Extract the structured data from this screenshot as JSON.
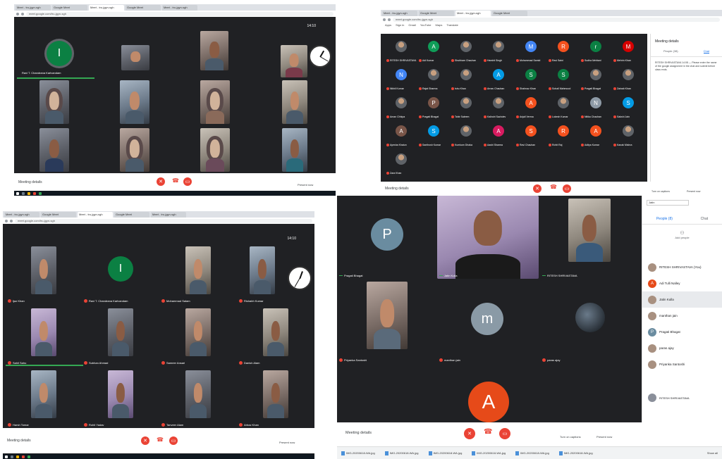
{
  "q1": {
    "tabs": [
      "Meet - tru-jgyn-sgh",
      "Google Meet",
      "Meet - tru-jgyn-sgh",
      "Google Meet",
      "Meet - tru-jgyn-sgh"
    ],
    "address": "meet.google.com/tru-jgyn-sgh",
    "clock_time": "14:10",
    "tiles": [
      {
        "name": "Ravi T. Chandrana Karlvandam"
      },
      {
        "name": ""
      },
      {
        "name": ""
      },
      {
        "name": ""
      },
      {
        "name": ""
      },
      {
        "name": ""
      },
      {
        "name": ""
      },
      {
        "name": ""
      },
      {
        "name": ""
      },
      {
        "name": ""
      },
      {
        "name": ""
      },
      {
        "name": ""
      }
    ],
    "avatar_letter": "I",
    "meeting_details": "Meeting details",
    "present_now": "Present now"
  },
  "q2": {
    "tabs": [
      "Meet - tru-jgyn-sgh",
      "Google Meet",
      "Meet - tru-jgyn-sgh",
      "Google Meet"
    ],
    "address": "meet.google.com/tru-jgyn-sgh",
    "bookmarks": [
      "Apps",
      "Sign in",
      "Gmail",
      "YouTube",
      "Maps",
      "Translate"
    ],
    "participants": [
      {
        "name": "RITESH SHRIVASTAVA",
        "letter": "",
        "color": "#5f6368"
      },
      {
        "name": "Adi Kumar",
        "letter": "A",
        "color": "#0f9d58"
      },
      {
        "name": "Shubham Chauhan",
        "letter": "",
        "color": "#5f6368"
      },
      {
        "name": "Harshit Singh",
        "letter": "",
        "color": "#5f6368"
      },
      {
        "name": "Mohammad Samid",
        "letter": "M",
        "color": "#4285f4"
      },
      {
        "name": "Ravi Saini",
        "letter": "R",
        "color": "#f4511e"
      },
      {
        "name": "Sudha Mehtani",
        "letter": "r",
        "color": "#0b8043"
      },
      {
        "name": "Mehrin Khan",
        "letter": "M",
        "color": "#d50000"
      },
      {
        "name": "Nikhil Kumar",
        "letter": "N",
        "color": "#4285f4"
      },
      {
        "name": "Rajat Sharma",
        "letter": "",
        "color": "#5f6368"
      },
      {
        "name": "Ishu Khan",
        "letter": "",
        "color": "#5f6368"
      },
      {
        "name": "Arnav Chauhan",
        "letter": "A",
        "color": "#039be5"
      },
      {
        "name": "Shahnaz Khan",
        "letter": "S",
        "color": "#0b8043"
      },
      {
        "name": "Sohail Mahmood",
        "letter": "S",
        "color": "#0b8043"
      },
      {
        "name": "Pragati Bhagat",
        "letter": "",
        "color": "#5f6368"
      },
      {
        "name": "Zainab Khan",
        "letter": "",
        "color": "#5f6368"
      },
      {
        "name": "Aman Chhipa",
        "letter": "",
        "color": "#5f6368"
      },
      {
        "name": "Pragati Bhagat",
        "letter": "P",
        "color": "#795548"
      },
      {
        "name": "Tahir Saleem",
        "letter": "",
        "color": "#5f6368"
      },
      {
        "name": "Kalindri Sachdev",
        "letter": "",
        "color": "#5f6368"
      },
      {
        "name": "Anjali Verma",
        "letter": "A",
        "color": "#f4511e"
      },
      {
        "name": "Lokesh Kumar",
        "letter": "",
        "color": "#5f6368"
      },
      {
        "name": "Nitika Chauhan",
        "letter": "N",
        "color": "#8e9aa6"
      },
      {
        "name": "Sakshi Jain",
        "letter": "S",
        "color": "#039be5"
      },
      {
        "name": "Ayesha Khatun",
        "letter": "A",
        "color": "#795548"
      },
      {
        "name": "Santhosh Kumar",
        "letter": "S",
        "color": "#039be5"
      },
      {
        "name": "Kumkum Dhaka",
        "letter": "",
        "color": "#5f6368"
      },
      {
        "name": "Aashi Sharma",
        "letter": "A",
        "color": "#d81b60"
      },
      {
        "name": "Ravi Chauhan",
        "letter": "S",
        "color": "#f4511e"
      },
      {
        "name": "Rohit Raj",
        "letter": "R",
        "color": "#f4511e"
      },
      {
        "name": "Aditya Kumar",
        "letter": "A",
        "color": "#f4511e"
      },
      {
        "name": "Kanak Mishra",
        "letter": "",
        "color": "#5f6368"
      },
      {
        "name": "Zara Khan",
        "letter": "",
        "color": "#5f6368"
      }
    ],
    "side_title": "Meeting details",
    "side_tabs": [
      "People (38)",
      "Chat"
    ],
    "side_message": "RITESH SHRIVASTAVA  14:08 — Please enter the name of the google assignment in the chat and submit before class ends.",
    "meeting_details": "Meeting details",
    "turn_on_captions": "Turn on captions",
    "present_now": "Present now"
  },
  "q3": {
    "tabs": [
      "Meet - tru-jgyn-sgh",
      "Google Meet",
      "Meet - tru-jgyn-sgh",
      "Google Meet",
      "Meet - tru-jgyn-sgh"
    ],
    "address": "meet.google.com/tru-jgyn-sgh",
    "clock_time": "14:10",
    "tiles": [
      {
        "name": "Ijaz Khan",
        "letter": "",
        "color": ""
      },
      {
        "name": "Ravi T. Chandrana Karlvandam",
        "letter": "I",
        "color": "#0b8043"
      },
      {
        "name": "Mohammad Salam",
        "letter": "",
        "color": ""
      },
      {
        "name": "Rishabh Kumar",
        "letter": "",
        "color": ""
      },
      {
        "name": "Sahil Sahu",
        "letter": "",
        "color": ""
      },
      {
        "name": "Subhan Ahmad",
        "letter": "",
        "color": ""
      },
      {
        "name": "Sameer Ansari",
        "letter": "",
        "color": ""
      },
      {
        "name": "Danish Alam",
        "letter": "",
        "color": ""
      },
      {
        "name": "Harsh Tomar",
        "letter": "",
        "color": ""
      },
      {
        "name": "Rohit Yadav",
        "letter": "",
        "color": ""
      },
      {
        "name": "Tanveer Alam",
        "letter": "",
        "color": ""
      },
      {
        "name": "Arbaz Khan",
        "letter": "",
        "color": ""
      }
    ],
    "meeting_details": "Meeting details",
    "present_now": "Present now"
  },
  "q4": {
    "tiles": [
      {
        "name": "Pragati Bhagat",
        "letter": "P",
        "color": "#6a8ca0"
      },
      {
        "name": "Jatin Kulla",
        "letter": "",
        "color": ""
      },
      {
        "name": "RITESH SHRIVASTAVA",
        "letter": "",
        "color": ""
      },
      {
        "name": "Priyanka Santoshi",
        "letter": "",
        "color": ""
      },
      {
        "name": "manthan jain",
        "letter": "m",
        "color": "#8a9aa6"
      },
      {
        "name": "paras ajay",
        "letter": "",
        "color": ""
      }
    ],
    "big_avatar_letter": "A",
    "big_avatar_color": "#e64a19",
    "side_search": "Jatin",
    "side_tabs": [
      "People (8)",
      "Chat"
    ],
    "add_people": "Add people",
    "people": [
      {
        "name": "RITESH SHRIVASTAVA (You)",
        "letter": ""
      },
      {
        "name": "Adi Tulli Nalley",
        "letter": "A"
      },
      {
        "name": "Jatin Kulla",
        "letter": ""
      },
      {
        "name": "manthan jain",
        "letter": ""
      },
      {
        "name": "Pragati Bhagat",
        "letter": "P"
      },
      {
        "name": "paras ajay",
        "letter": ""
      },
      {
        "name": "Priyanka Santoshi",
        "letter": ""
      }
    ],
    "presenting": "RITESH SHRIVASTAVA",
    "meeting_details": "Meeting details",
    "turn_on_captions": "Turn on captions",
    "present_now": "Present now",
    "downloads": [
      "IMG-20200618-WA.jpg",
      "IMG-20200618-WA.jpg",
      "IMG-20200618-WA.jpg",
      "IMG-20200618-WA.jpg",
      "IMG-20200618-WA.jpg",
      "IMG-20200618-WA.jpg"
    ],
    "show_all": "Show all"
  },
  "colors": {
    "hangup_red": "#ea4335",
    "meet_dark": "#202124",
    "accent_blue": "#1a73e8"
  }
}
